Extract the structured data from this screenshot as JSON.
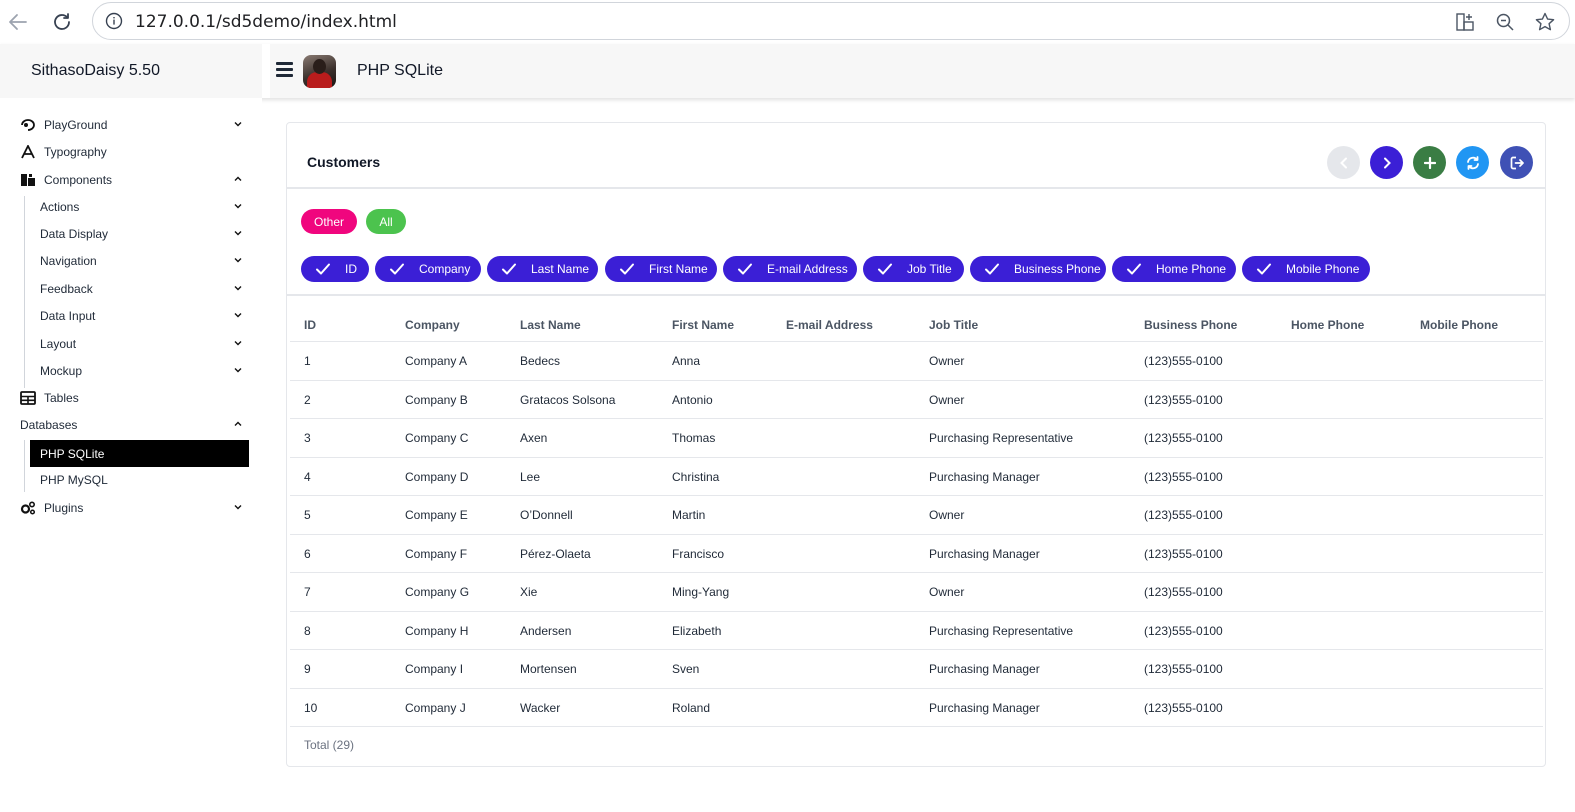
{
  "browser": {
    "url": "127.0.0.1/sd5demo/index.html"
  },
  "header": {
    "brand": "SithasoDaisy 5.50",
    "page_title": "PHP SQLite"
  },
  "sidebar": {
    "items": [
      {
        "label": "PlayGround",
        "icon": "playground-icon",
        "expand": "down"
      },
      {
        "label": "Typography",
        "icon": "typography-icon"
      },
      {
        "label": "Components",
        "icon": "components-icon",
        "expand": "up"
      },
      {
        "label": "Actions",
        "sub": true,
        "expand": "down"
      },
      {
        "label": "Data Display",
        "sub": true,
        "expand": "down"
      },
      {
        "label": "Navigation",
        "sub": true,
        "expand": "down"
      },
      {
        "label": "Feedback",
        "sub": true,
        "expand": "down"
      },
      {
        "label": "Data Input",
        "sub": true,
        "expand": "down"
      },
      {
        "label": "Layout",
        "sub": true,
        "expand": "down"
      },
      {
        "label": "Mockup",
        "sub": true,
        "expand": "down"
      },
      {
        "label": "Tables",
        "icon": "table-icon"
      },
      {
        "label": "Databases",
        "expand": "up"
      },
      {
        "label": "PHP SQLite",
        "sub": true,
        "active": true
      },
      {
        "label": "PHP MySQL",
        "sub": true
      },
      {
        "label": "Plugins",
        "icon": "gears-icon",
        "expand": "down"
      }
    ]
  },
  "card": {
    "title": "Customers",
    "filters": [
      {
        "label": "Other",
        "color": "#f0067e"
      },
      {
        "label": "All",
        "color": "#4cc34e"
      }
    ],
    "column_chips": [
      "ID",
      "Company",
      "Last Name",
      "First Name",
      "E-mail Address",
      "Job Title",
      "Business Phone",
      "Home Phone",
      "Mobile Phone"
    ],
    "action_colors": {
      "prev": "#e5e7eb",
      "next": "#3b1fd6",
      "add": "#3a7d44",
      "refresh": "#2196f3",
      "exit": "#3f51b5"
    }
  },
  "table": {
    "headers": [
      "ID",
      "Company",
      "Last Name",
      "First Name",
      "E-mail Address",
      "Job Title",
      "Business Phone",
      "Home Phone",
      "Mobile Phone"
    ],
    "rows": [
      [
        "1",
        "Company A",
        "Bedecs",
        "Anna",
        "",
        "Owner",
        "(123)555-0100",
        "",
        ""
      ],
      [
        "2",
        "Company B",
        "Gratacos Solsona",
        "Antonio",
        "",
        "Owner",
        "(123)555-0100",
        "",
        ""
      ],
      [
        "3",
        "Company C",
        "Axen",
        "Thomas",
        "",
        "Purchasing Representative",
        "(123)555-0100",
        "",
        ""
      ],
      [
        "4",
        "Company D",
        "Lee",
        "Christina",
        "",
        "Purchasing Manager",
        "(123)555-0100",
        "",
        ""
      ],
      [
        "5",
        "Company E",
        "O’Donnell",
        "Martin",
        "",
        "Owner",
        "(123)555-0100",
        "",
        ""
      ],
      [
        "6",
        "Company F",
        "Pérez-Olaeta",
        "Francisco",
        "",
        "Purchasing Manager",
        "(123)555-0100",
        "",
        ""
      ],
      [
        "7",
        "Company G",
        "Xie",
        "Ming-Yang",
        "",
        "Owner",
        "(123)555-0100",
        "",
        ""
      ],
      [
        "8",
        "Company H",
        "Andersen",
        "Elizabeth",
        "",
        "Purchasing Representative",
        "(123)555-0100",
        "",
        ""
      ],
      [
        "9",
        "Company I",
        "Mortensen",
        "Sven",
        "",
        "Purchasing Manager",
        "(123)555-0100",
        "",
        ""
      ],
      [
        "10",
        "Company J",
        "Wacker",
        "Roland",
        "",
        "Purchasing Manager",
        "(123)555-0100",
        "",
        ""
      ]
    ],
    "total": "Total (29)"
  }
}
